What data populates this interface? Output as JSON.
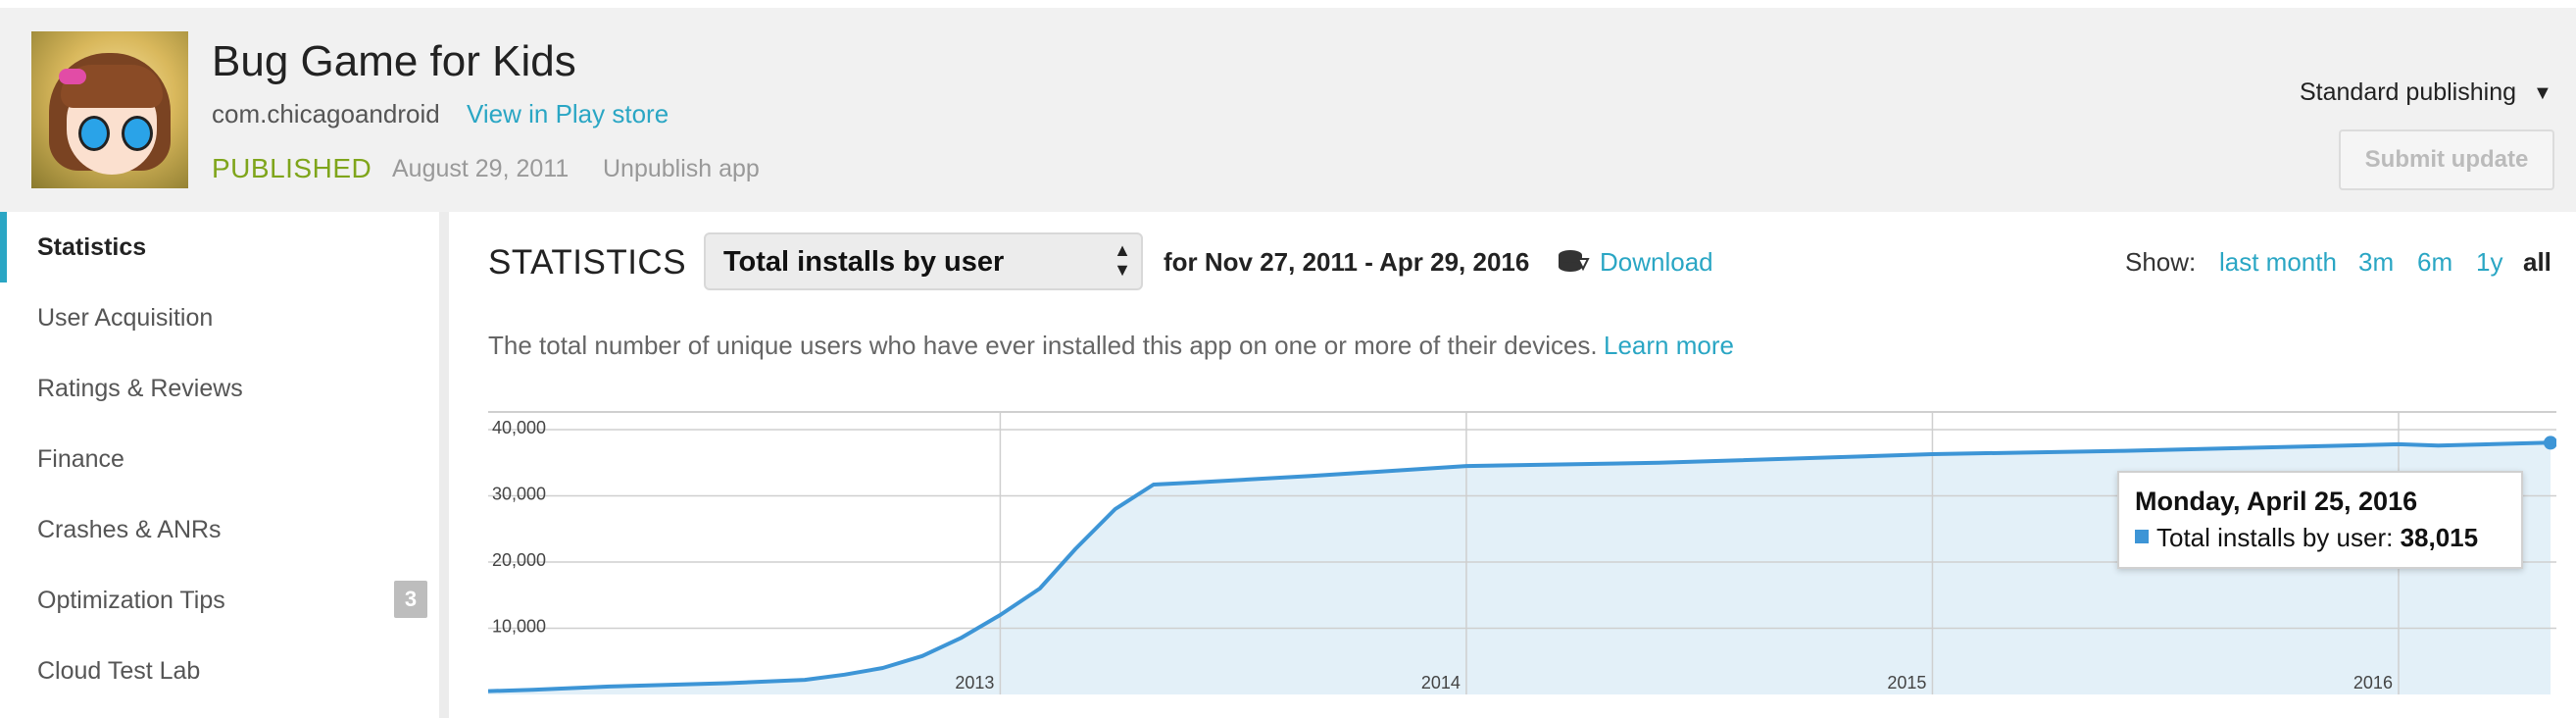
{
  "app": {
    "title": "Bug Game for Kids",
    "package": "com.chicagoandroid",
    "view_link": "View in Play store",
    "status": "PUBLISHED",
    "date": "August 29, 2011",
    "unpublish": "Unpublish app"
  },
  "publishing": {
    "mode": "Standard publishing",
    "arrow": "▼",
    "submit": "Submit update"
  },
  "sidebar": {
    "items": [
      {
        "label": "Statistics",
        "active": true
      },
      {
        "label": "User Acquisition"
      },
      {
        "label": "Ratings & Reviews"
      },
      {
        "label": "Finance"
      },
      {
        "label": "Crashes & ANRs"
      },
      {
        "label": "Optimization Tips",
        "badge": "3"
      },
      {
        "label": "Cloud Test Lab"
      }
    ]
  },
  "stats": {
    "title": "STATISTICS",
    "metric": "Total installs by user",
    "range": "for Nov 27, 2011 - Apr 29, 2016",
    "download": "Download",
    "show_label": "Show:",
    "show_options": [
      "last month",
      "3m",
      "6m",
      "1y",
      "all"
    ],
    "show_selected": "all",
    "description": "The total number of unique users who have ever installed this app on one or more of their devices.",
    "learn_more": "Learn more"
  },
  "colors": {
    "accent": "#2aa6c4",
    "published": "#7fa51b",
    "series": "#3d95d6",
    "area": "#e3f0f8"
  },
  "chart_data": {
    "type": "area",
    "y_ticks": [
      "10,000",
      "20,000",
      "30,000",
      "40,000"
    ],
    "x_ticks": [
      "2013",
      "2014",
      "2015",
      "2016"
    ],
    "ylim": [
      0,
      40000
    ],
    "grid": true,
    "series": [
      {
        "name": "Total installs by user",
        "points": [
          [
            "2011-11-27",
            500
          ],
          [
            "2012-01-01",
            700
          ],
          [
            "2012-03-01",
            1200
          ],
          [
            "2012-06-01",
            1700
          ],
          [
            "2012-08-01",
            2200
          ],
          [
            "2012-09-01",
            3000
          ],
          [
            "2012-10-01",
            4000
          ],
          [
            "2012-11-01",
            5800
          ],
          [
            "2012-12-01",
            8500
          ],
          [
            "2013-01-01",
            12000
          ],
          [
            "2013-02-01",
            16000
          ],
          [
            "2013-03-01",
            22000
          ],
          [
            "2013-04-01",
            28000
          ],
          [
            "2013-05-01",
            31700
          ],
          [
            "2013-06-01",
            32000
          ],
          [
            "2013-09-01",
            33000
          ],
          [
            "2014-01-01",
            34500
          ],
          [
            "2014-06-01",
            35000
          ],
          [
            "2015-01-01",
            36300
          ],
          [
            "2015-06-01",
            36800
          ],
          [
            "2016-01-01",
            37800
          ],
          [
            "2016-02-01",
            37600
          ],
          [
            "2016-04-25",
            38015
          ],
          [
            "2016-04-29",
            38015
          ]
        ]
      }
    ],
    "tooltip": {
      "date": "Monday, April 25, 2016",
      "label": "Total installs by user:",
      "value": "38,015"
    }
  }
}
